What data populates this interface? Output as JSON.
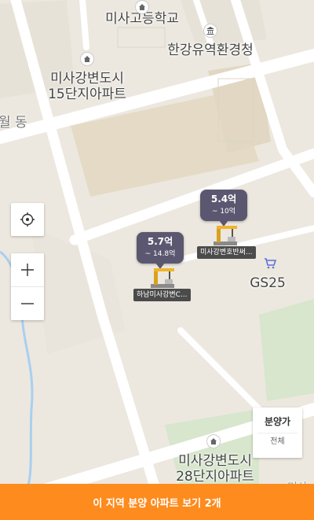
{
  "map": {
    "labels": {
      "misa_high_school": "미사고등학교",
      "hangang_env": "한강유역환경청",
      "complex_15_line1": "미사강변도시",
      "complex_15_line2": "15단지아파트",
      "wol_dong": "월 동",
      "gs25": "GS25",
      "complex_28_line1": "미사강변도시",
      "complex_28_line2": "28단지아파트",
      "edge_partial": "미사"
    }
  },
  "controls": {
    "locate_icon": "crosshair-icon",
    "zoom_in_icon": "plus-icon",
    "zoom_out_icon": "minus-icon"
  },
  "listings": [
    {
      "price": "5.4억",
      "range": "~ 10억",
      "name": "미사강변호반써..."
    },
    {
      "price": "5.7억",
      "range": "~ 14.8억",
      "name": "하남미사강변C..."
    }
  ],
  "price_filter": {
    "title": "분양가",
    "value": "전체"
  },
  "bottom_bar": {
    "label": "이 지역 분양 아파트 보기 2개"
  },
  "colors": {
    "accent": "#fd8b1e",
    "bubble": "#5c5770",
    "road": "#ffffff",
    "park": "#cfe3c2",
    "water": "#a9cff0"
  }
}
